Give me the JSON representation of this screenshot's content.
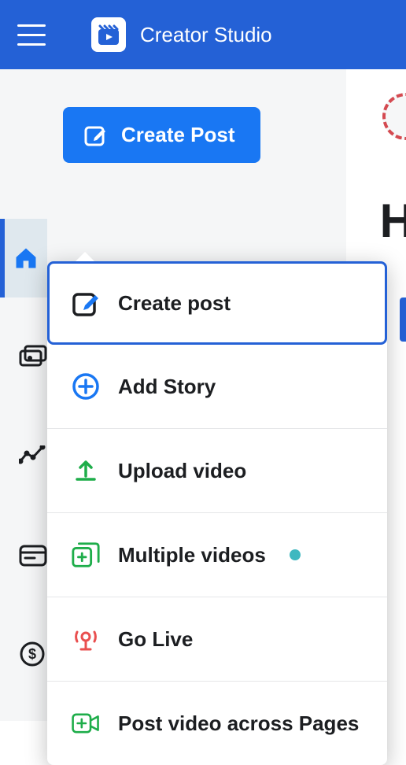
{
  "header": {
    "title": "Creator Studio"
  },
  "create_button": {
    "label": "Create Post"
  },
  "dropdown": {
    "items": [
      {
        "label": "Create post",
        "highlighted": true
      },
      {
        "label": "Add Story"
      },
      {
        "label": "Upload video"
      },
      {
        "label": "Multiple videos",
        "has_dot": true
      },
      {
        "label": "Go Live"
      },
      {
        "label": "Post video across Pages"
      }
    ]
  },
  "partial_text": "H"
}
